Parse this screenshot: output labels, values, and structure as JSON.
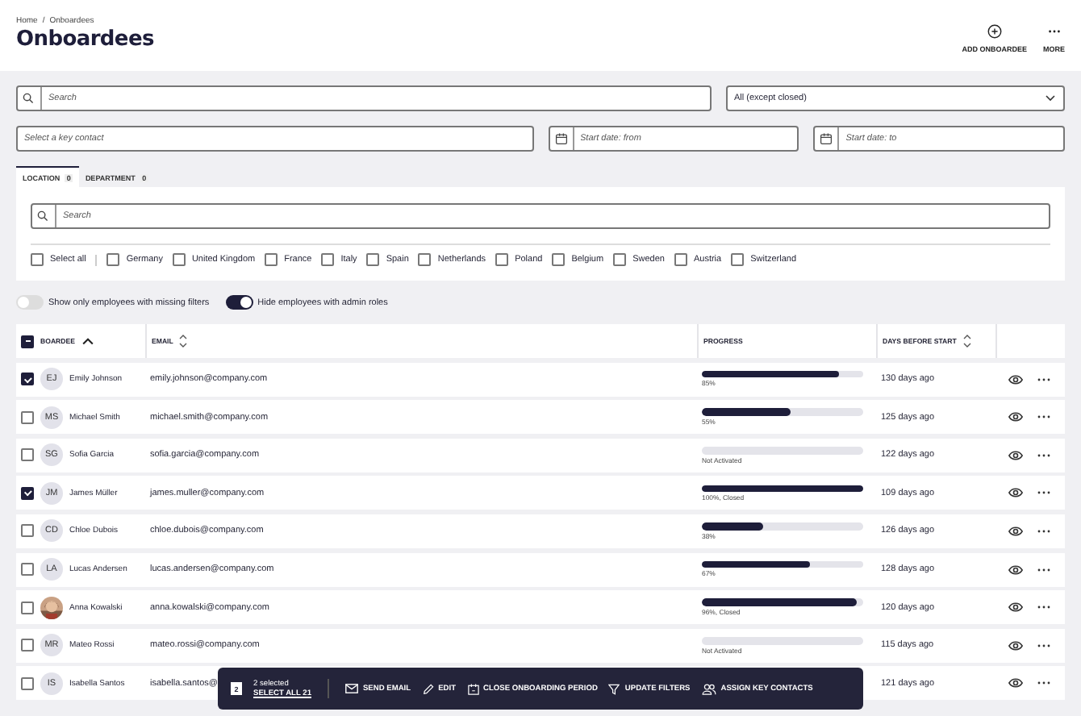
{
  "breadcrumb": {
    "items": [
      "Home",
      "Onboardees"
    ],
    "separator": "/"
  },
  "title": "Onboardees",
  "header_actions": [
    {
      "kind": "add",
      "label": "ADD ONBOARDEE"
    },
    {
      "kind": "more",
      "label": "MORE"
    }
  ],
  "filters": {
    "search": {
      "placeholder": "Search"
    },
    "status": {
      "value": "All (except closed)"
    },
    "key_contact": {
      "placeholder": "Select a key contact"
    },
    "date_from": {
      "placeholder": "Start date: from"
    },
    "date_to": {
      "placeholder": "Start date: to"
    }
  },
  "tabs": [
    {
      "label": "LOCATION",
      "count": "0",
      "selected": true
    },
    {
      "label": "DEPARTMENT",
      "count": "0",
      "selected": false
    }
  ],
  "location_panel": {
    "search": {
      "placeholder": "Search"
    },
    "options": [
      {
        "label": "Select all",
        "checked": false
      },
      {
        "label": "Germany",
        "checked": false
      },
      {
        "label": "United Kingdom",
        "checked": false
      },
      {
        "label": "France",
        "checked": false
      },
      {
        "label": "Italy",
        "checked": false
      },
      {
        "label": "Spain",
        "checked": false
      },
      {
        "label": "Netherlands",
        "checked": false
      },
      {
        "label": "Poland",
        "checked": false
      },
      {
        "label": "Belgium",
        "checked": false
      },
      {
        "label": "Sweden",
        "checked": false
      },
      {
        "label": "Austria",
        "checked": false
      },
      {
        "label": "Switzerland",
        "checked": false
      }
    ]
  },
  "toggles": [
    {
      "label": "Show only employees with missing filters",
      "on": false
    },
    {
      "label": "Hide employees with admin roles",
      "on": true
    }
  ],
  "table": {
    "select_all": {
      "indeterminate": true
    },
    "columns": [
      {
        "label": "BOARDEE",
        "sortable": true,
        "sorted_ascending": true
      },
      {
        "label": "EMAIL",
        "sortable": true,
        "sorted_ascending": false
      },
      {
        "label": "PROGRESS",
        "sortable": false
      },
      {
        "label": "DAYS BEFORE START",
        "sortable": true,
        "sorted_ascending": false
      }
    ],
    "rows": [
      {
        "selected": true,
        "avatar": {
          "kind": "initials",
          "text": "EJ"
        },
        "name": "Emily Johnson",
        "email": "emily.johnson@company.com",
        "progress": {
          "level": 0.85,
          "label": "85%"
        },
        "days": "130 days ago"
      },
      {
        "selected": false,
        "avatar": {
          "kind": "initials",
          "text": "MS"
        },
        "name": "Michael Smith",
        "email": "michael.smith@company.com",
        "progress": {
          "level": 0.55,
          "label": "55%"
        },
        "days": "125 days ago"
      },
      {
        "selected": false,
        "avatar": {
          "kind": "initials",
          "text": "SG"
        },
        "name": "Sofia Garcia",
        "email": "sofia.garcia@company.com",
        "progress": {
          "level": 0,
          "label": "Not Activated"
        },
        "days": "122 days ago"
      },
      {
        "selected": true,
        "avatar": {
          "kind": "initials",
          "text": "JM"
        },
        "name": "James Müller",
        "email": "james.muller@company.com",
        "progress": {
          "level": 1,
          "label": "100%, Closed"
        },
        "days": "109 days ago"
      },
      {
        "selected": false,
        "avatar": {
          "kind": "initials",
          "text": "CD"
        },
        "name": "Chloe Dubois",
        "email": "chloe.dubois@company.com",
        "progress": {
          "level": 0.38,
          "label": "38%"
        },
        "days": "126 days ago"
      },
      {
        "selected": false,
        "avatar": {
          "kind": "initials",
          "text": "LA"
        },
        "name": "Lucas Andersen",
        "email": "lucas.andersen@company.com",
        "progress": {
          "level": 0.67,
          "label": "67%"
        },
        "days": "128 days ago"
      },
      {
        "selected": false,
        "name": "Anna Kowalski",
        "email": "anna.kowalski@company.com",
        "progress": {
          "level": 0.96,
          "label": "96%, Closed"
        },
        "days": "120 days ago"
      },
      {
        "selected": false,
        "avatar": {
          "kind": "initials",
          "text": "MR"
        },
        "name": "Mateo Rossi",
        "email": "mateo.rossi@company.com",
        "progress": {
          "level": 0,
          "label": "Not Activated"
        },
        "days": "115 days ago"
      },
      {
        "selected": false,
        "avatar": {
          "kind": "initials",
          "text": "IS"
        },
        "name": "Isabella Santos",
        "email": "isabella.santos@",
        "days": "121 days ago"
      }
    ]
  },
  "action_bar": {
    "count": "2",
    "selected_text": "2 selected",
    "select_all": "SELECT ALL 21",
    "actions": [
      {
        "kind": "email",
        "label": "SEND EMAIL"
      },
      {
        "kind": "edit",
        "label": "EDIT"
      },
      {
        "kind": "close",
        "label": "CLOSE ONBOARDING PERIOD"
      },
      {
        "kind": "filter",
        "label": "UPDATE FILTERS"
      },
      {
        "kind": "contacts",
        "label": "ASSIGN KEY CONTACTS"
      }
    ]
  }
}
